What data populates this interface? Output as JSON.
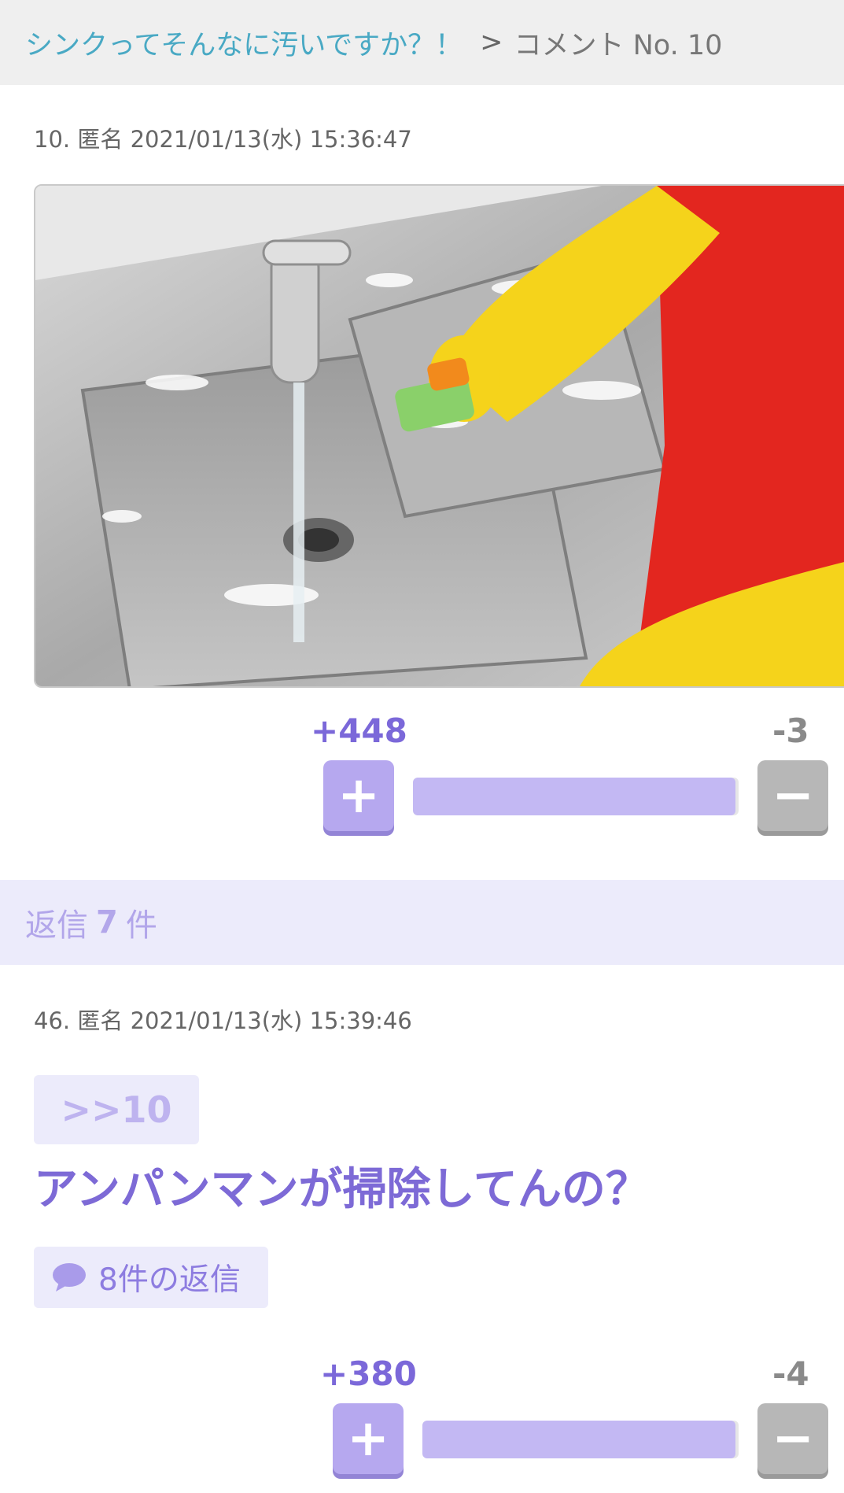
{
  "breadcrumb": {
    "topic_title": "シンクってそんなに汚いですか？！",
    "separator": ">",
    "current": "コメント No. 10"
  },
  "comments": [
    {
      "number": "10.",
      "author": "匿名",
      "datetime": "2021/01/13(水) 15:36:47",
      "image_alt": "sink-cleaning-photo",
      "votes": {
        "plus": "+448",
        "minus": "-3",
        "plus_fraction": 0.99
      }
    }
  ],
  "replies_header": {
    "prefix": "返信",
    "count": "7",
    "suffix": "件"
  },
  "replies": [
    {
      "number": "46.",
      "author": "匿名",
      "datetime": "2021/01/13(水) 15:39:46",
      "anchor": ">>10",
      "text": "アンパンマンが掃除してんの？",
      "reply_count_label": "8件の返信",
      "votes": {
        "plus": "+380",
        "minus": "-4",
        "plus_fraction": 0.99
      }
    }
  ],
  "icons": {
    "plus": "plus-icon",
    "minus": "minus-icon",
    "reply": "speech-bubble-icon"
  },
  "colors": {
    "accent": "#7b68d9",
    "link": "#49a9c4",
    "plus_button": "#b6a8ef",
    "minus_button": "#b7b7b7"
  }
}
